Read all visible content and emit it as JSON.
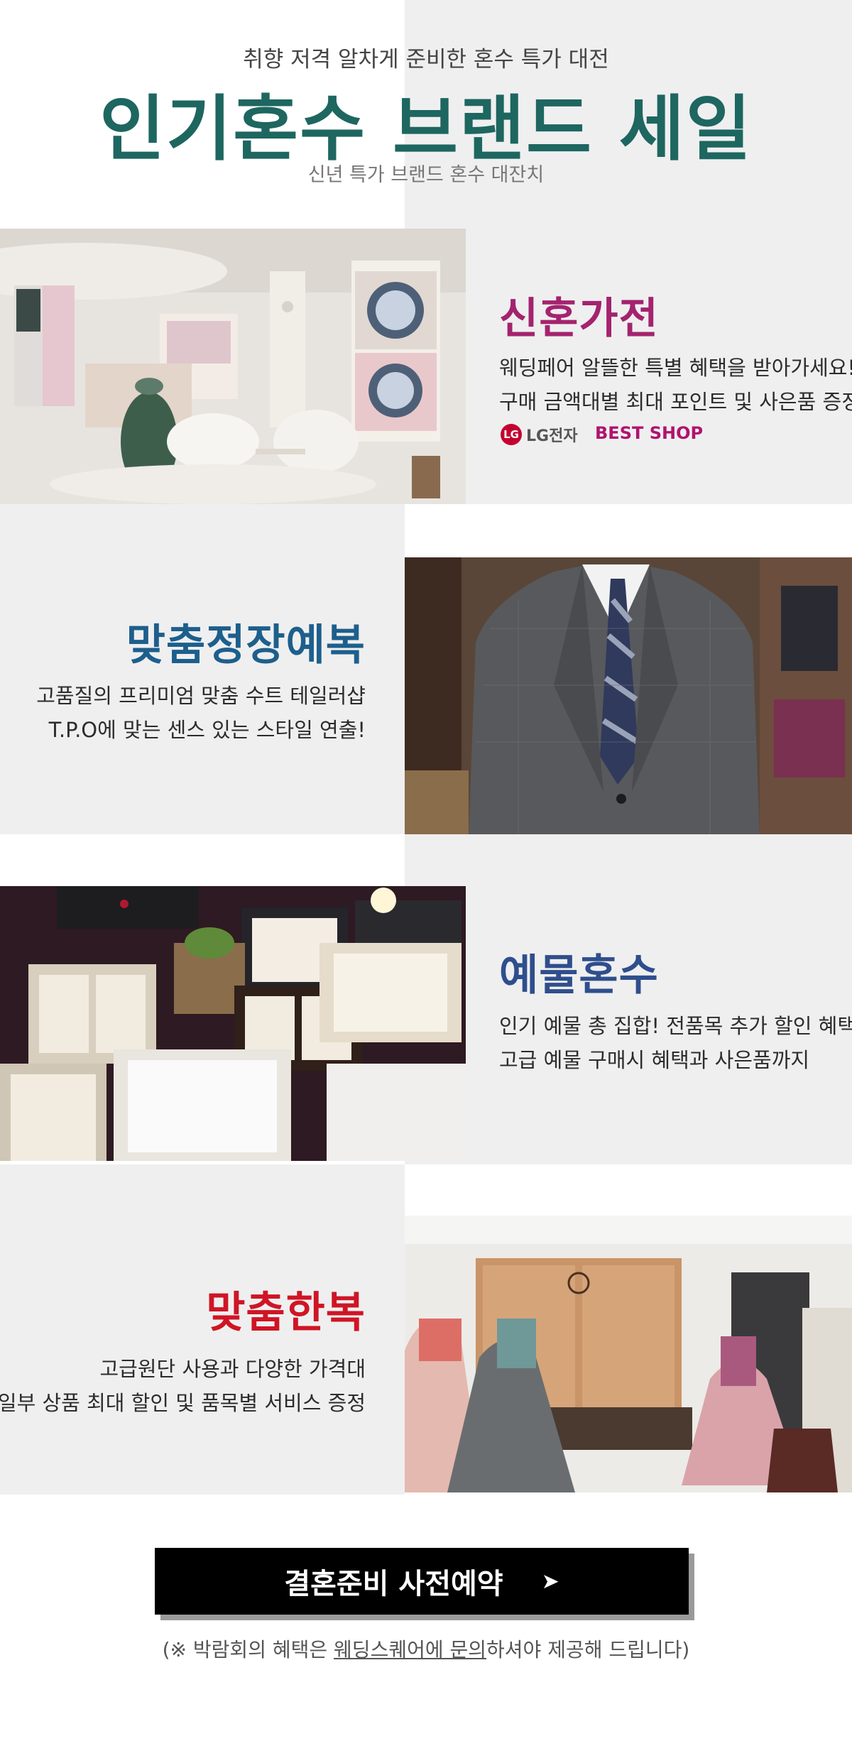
{
  "header": {
    "tagline": "취향 저격 알차게 준비한 혼수 특가 대전",
    "title": "인기혼수 브랜드 세일",
    "subtitle": "신년 특가 브랜드 혼수 대잔치"
  },
  "sections": [
    {
      "title": "신혼가전",
      "color": "#a4236e",
      "lines": [
        "웨딩페어 알뜰한 특별 혜택을 받아가세요!",
        "구매 금액대별 최대 포인트 및 사은품 증정!"
      ],
      "brand_logo": "LG전자",
      "brand_logo_mark": "LG",
      "brand_store": "BEST SHOP"
    },
    {
      "title": "맞춤정장예복",
      "color": "#1d5f8c",
      "lines": [
        "고품질의 프리미엄  맞춤 수트 테일러샵",
        "T.P.O에 맞는 센스 있는 스타일 연출!"
      ]
    },
    {
      "title": "예물혼수",
      "color": "#2f4e8c",
      "lines": [
        "인기 예물 총 집합! 전품목 추가 할인 혜택",
        "고급 예물 구매시 혜택과 사은품까지"
      ]
    },
    {
      "title": "맞춤한복",
      "color": "#cf1525",
      "lines": [
        "고급원단 사용과 다양한 가격대",
        "일부 상품 최대 할인 및 품목별 서비스 증정"
      ]
    }
  ],
  "cta": {
    "label": "결혼준비 사전예약",
    "arrow": "➤"
  },
  "note": {
    "prefix": "(※ 박람회의 혜택은 ",
    "link": "웨딩스퀘어에 문의",
    "suffix": "하셔야 제공해 드립니다)"
  }
}
